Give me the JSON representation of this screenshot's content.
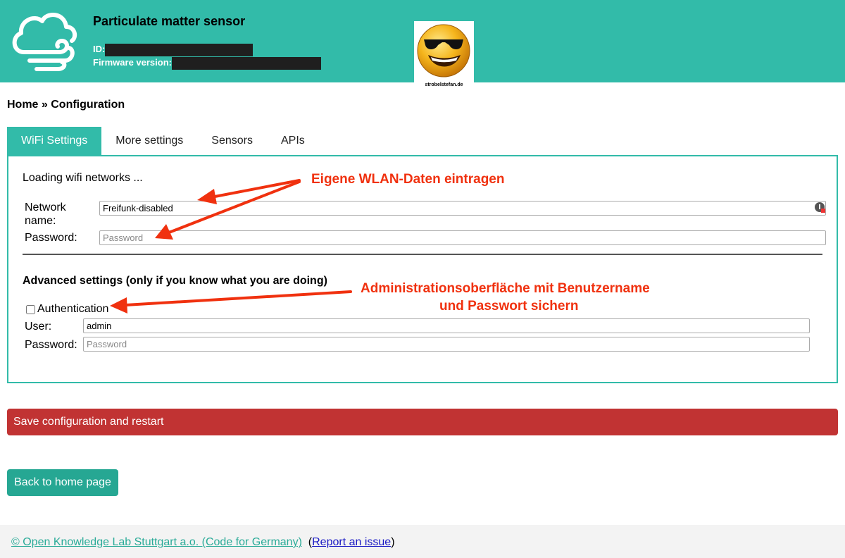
{
  "header": {
    "title": "Particulate matter sensor",
    "id_label": "ID:",
    "firmware_label": "Firmware version:",
    "smiley_caption": "strobelstefan.de",
    "cloud_icon": "cloud-wind-icon",
    "smiley_icon": "cool-smiley-icon"
  },
  "breadcrumb": "Home » Configuration",
  "tabs": [
    {
      "label": "WiFi Settings",
      "active": true
    },
    {
      "label": "More settings"
    },
    {
      "label": "Sensors"
    },
    {
      "label": "APIs"
    }
  ],
  "wifi": {
    "loading_text": "Loading wifi networks ...",
    "network_label": "Network name:",
    "network_value": "Freifunk-disabled",
    "password_label": "Password:",
    "password_placeholder": "Password"
  },
  "advanced": {
    "heading": "Advanced settings (only if you know what you are doing)",
    "auth_label": "Authentication",
    "auth_checked": false,
    "user_label": "User:",
    "user_value": "admin",
    "password_label": "Password:",
    "password_placeholder": "Password"
  },
  "annotations": {
    "wlan": "Eigene WLAN-Daten eintragen",
    "admin_line1": "Administrationsoberfläche mit Benutzername",
    "admin_line2": "und Passwort sichern",
    "color": "#f0310f"
  },
  "buttons": {
    "save": "Save configuration and restart",
    "back": "Back to home page"
  },
  "footer": {
    "copyright": "© Open Knowledge Lab Stuttgart a.o. (Code for Germany)",
    "open_paren": "(",
    "report": "Report an issue",
    "close_paren": ")"
  },
  "colors": {
    "brand": "#32bba9",
    "save_button": "#c13333",
    "back_button": "#26a793",
    "footer_link": "#2aab98",
    "report_link": "#1a1ac4"
  }
}
